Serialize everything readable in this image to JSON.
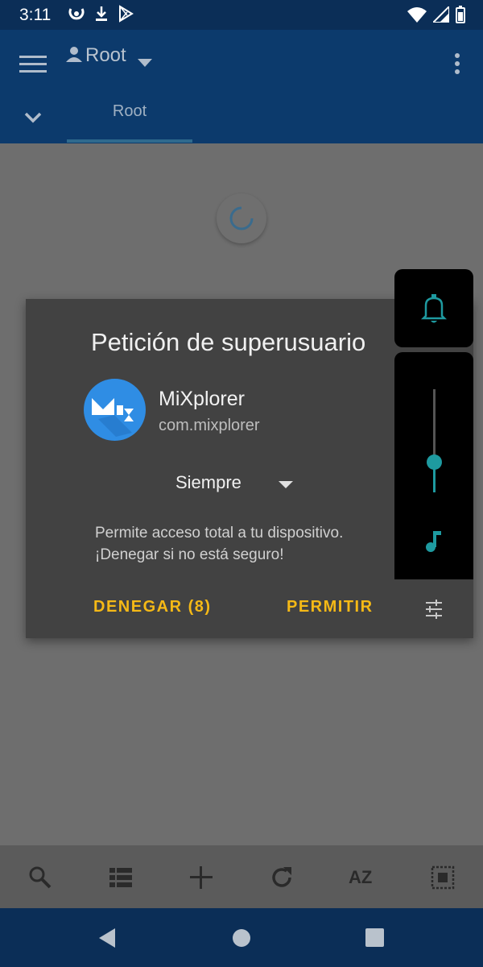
{
  "status_bar": {
    "time": "3:11",
    "icons": [
      "sync-icon",
      "download-icon",
      "play-store-icon",
      "wifi-icon",
      "signal-icon",
      "battery-icon"
    ]
  },
  "app_bar": {
    "title": "Root",
    "tab_label": "Root"
  },
  "dialog": {
    "title": "Petición de superusuario",
    "app_name": "MiXplorer",
    "app_package": "com.mixplorer",
    "duration_selected": "Siempre",
    "warning_line1": "Permite acceso total a tu dispositivo.",
    "warning_line2": "¡Denegar si no está seguro!",
    "deny_label": "DENEGAR (8)",
    "allow_label": "PERMITIR"
  },
  "volume_panel": {
    "level": 0.3,
    "accent_color": "#1e9aa0"
  },
  "toolbar": {
    "sort_label": "AZ",
    "icons": [
      "search-icon",
      "list-view-icon",
      "add-icon",
      "refresh-icon",
      "sort-icon",
      "select-all-icon"
    ]
  },
  "colors": {
    "status_bar": "#0b2e57",
    "app_bar": "#0c3a6c",
    "dialog_bg": "#424242",
    "button_text": "#f5b916",
    "app_icon": "#2f8de4"
  }
}
